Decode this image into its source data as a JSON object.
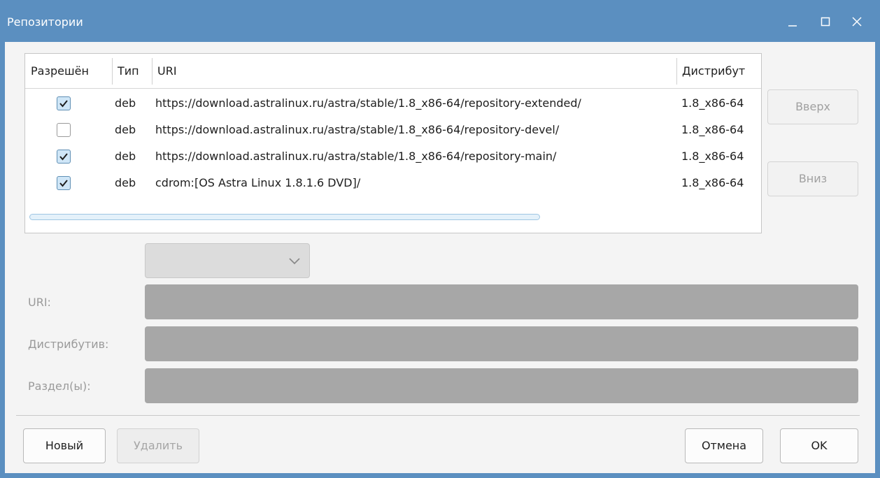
{
  "window": {
    "title": "Репозитории"
  },
  "list": {
    "columns": [
      "Разрешён",
      "Тип",
      "URI",
      "Дистрибут"
    ],
    "rows": [
      {
        "enabled": true,
        "type": "deb",
        "uri": "https://download.astralinux.ru/astra/stable/1.8_x86-64/repository-extended/",
        "dist": "1.8_x86-64"
      },
      {
        "enabled": false,
        "type": "deb",
        "uri": "https://download.astralinux.ru/astra/stable/1.8_x86-64/repository-devel/",
        "dist": "1.8_x86-64"
      },
      {
        "enabled": true,
        "type": "deb",
        "uri": "https://download.astralinux.ru/astra/stable/1.8_x86-64/repository-main/",
        "dist": "1.8_x86-64"
      },
      {
        "enabled": true,
        "type": "deb",
        "uri": "cdrom:[OS Astra Linux 1.8.1.6  DVD]/",
        "dist": "1.8_x86-64"
      }
    ]
  },
  "side_buttons": {
    "up": "Вверх",
    "down": "Вниз"
  },
  "form": {
    "uri_label": "URI:",
    "dist_label": "Дистрибутив:",
    "sections_label": "Раздел(ы):"
  },
  "bottom_buttons": {
    "new": "Новый",
    "delete": "Удалить",
    "cancel": "Отмена",
    "ok": "OK"
  },
  "colors": {
    "titlebar": "#5b8fc0",
    "checkbox_checked": "#cfe6f7",
    "check_mark": "#1e1e1e"
  }
}
